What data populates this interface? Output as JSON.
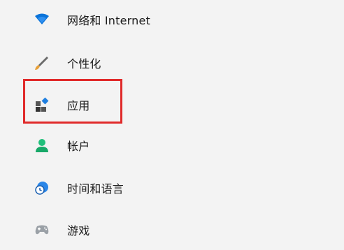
{
  "sidebar": {
    "items": [
      {
        "id": "network",
        "label": "网络和 Internet",
        "icon": "wifi-icon"
      },
      {
        "id": "personalization",
        "label": "个性化",
        "icon": "brush-icon"
      },
      {
        "id": "apps",
        "label": "应用",
        "icon": "apps-icon"
      },
      {
        "id": "accounts",
        "label": "帐户",
        "icon": "person-icon"
      },
      {
        "id": "time",
        "label": "时间和语言",
        "icon": "globe-clock-icon"
      },
      {
        "id": "gaming",
        "label": "游戏",
        "icon": "gamepad-icon"
      }
    ],
    "highlighted_item": "apps"
  },
  "colors": {
    "background": "#f3f3f3",
    "highlight_border": "#e02a2a",
    "accent_blue": "#0a73d9",
    "accent_green": "#1fbf7a"
  }
}
